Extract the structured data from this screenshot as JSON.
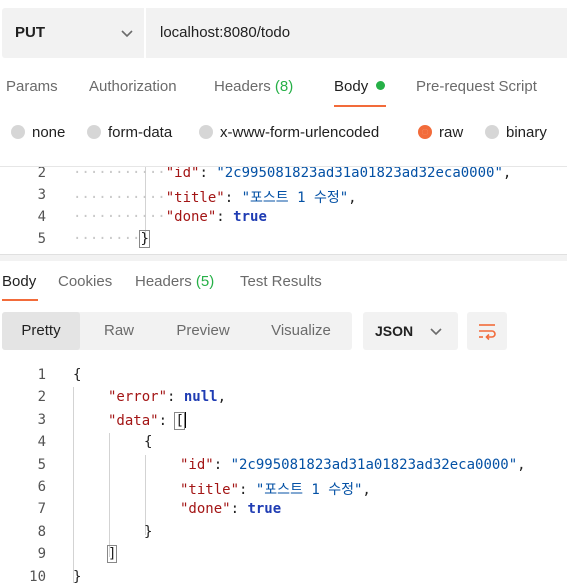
{
  "request": {
    "method": "PUT",
    "url": "localhost:8080/todo"
  },
  "request_tabs": {
    "params": "Params",
    "authorization": "Authorization",
    "headers": "Headers",
    "headers_count": "(8)",
    "body": "Body",
    "prerequest": "Pre-request Script"
  },
  "body_types": {
    "none": "none",
    "form_data": "form-data",
    "urlencoded": "x-www-form-urlencoded",
    "raw": "raw",
    "binary": "binary",
    "selected": "raw"
  },
  "request_body": {
    "lines": [
      {
        "num": "2",
        "key": "\"id\"",
        "value": "\"2c995081823ad31a01823ad32eca0000\"",
        "tail": ","
      },
      {
        "num": "3",
        "key": "\"title\"",
        "value": "\"포스트 1 수정\"",
        "tail": ","
      },
      {
        "num": "4",
        "key": "\"done\"",
        "value": "true",
        "tail": ""
      },
      {
        "num": "5",
        "brace": "}"
      }
    ]
  },
  "response_tabs": {
    "body": "Body",
    "cookies": "Cookies",
    "headers": "Headers",
    "headers_count": "(5)",
    "test_results": "Test Results"
  },
  "view_modes": {
    "pretty": "Pretty",
    "raw": "Raw",
    "preview": "Preview",
    "visualize": "Visualize",
    "format": "JSON"
  },
  "response_body": {
    "line_numbers": [
      "1",
      "2",
      "3",
      "4",
      "5",
      "6",
      "7",
      "8",
      "9",
      "10"
    ],
    "open_brace": "{",
    "error_key": "\"error\"",
    "error_value": "null",
    "data_key": "\"data\"",
    "data_open": "[",
    "item_open": "{",
    "id_key": "\"id\"",
    "id_value": "\"2c995081823ad31a01823ad32eca0000\"",
    "title_key": "\"title\"",
    "title_value": "\"포스트 1 수정\"",
    "done_key": "\"done\"",
    "done_value": "true",
    "item_close": "}",
    "data_close": "]",
    "close_brace": "}"
  },
  "colors": {
    "accent": "#f26b3a",
    "success": "#26b047",
    "json_key": "#a31515",
    "json_string": "#0451a5",
    "json_keyword": "#1f3cb3"
  }
}
